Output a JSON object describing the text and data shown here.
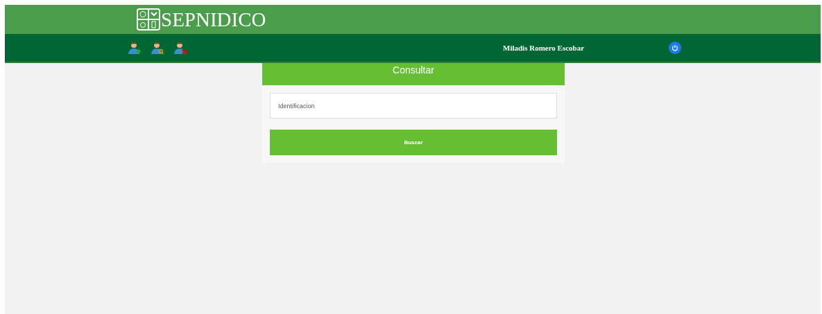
{
  "header": {
    "logo_text": "SEPNIDICO"
  },
  "nav": {
    "user_name": "Miladis Romero Escobar"
  },
  "card": {
    "title": "Consultar",
    "field": {
      "placeholder": "Identificacion"
    },
    "button": "Buscar"
  }
}
